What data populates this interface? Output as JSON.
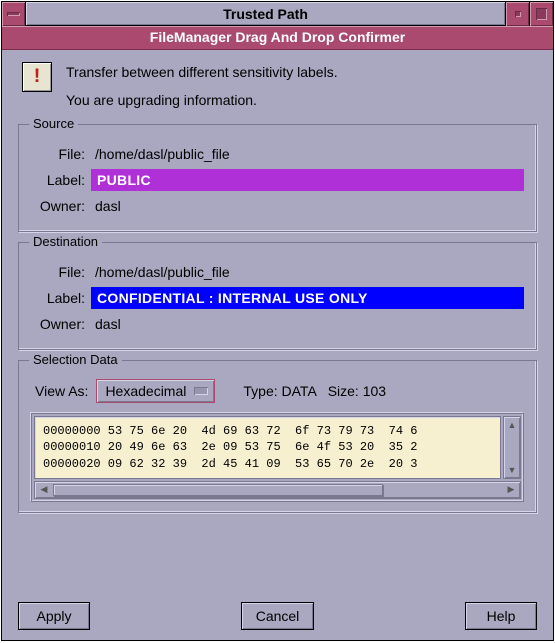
{
  "window": {
    "title": "Trusted Path",
    "subtitle": "FileManager Drag And Drop Confirmer"
  },
  "message": {
    "line1": "Transfer between different sensitivity labels.",
    "line2": "You are upgrading information."
  },
  "source": {
    "legend": "Source",
    "file_label": "File:",
    "file_value": "/home/dasl/public_file",
    "label_label": "Label:",
    "label_value": "PUBLIC",
    "label_color": "#b030d8",
    "owner_label": "Owner:",
    "owner_value": "dasl"
  },
  "destination": {
    "legend": "Destination",
    "file_label": "File:",
    "file_value": "/home/dasl/public_file",
    "label_label": "Label:",
    "label_value": "CONFIDENTIAL : INTERNAL USE ONLY",
    "label_color": "#0000ff",
    "owner_label": "Owner:",
    "owner_value": "dasl"
  },
  "selection": {
    "legend": "Selection Data",
    "viewas_label": "View As:",
    "viewas_value": "Hexadecimal",
    "type_label": "Type:",
    "type_value": "DATA",
    "size_label": "Size:",
    "size_value": "103",
    "hexdump": "00000000 53 75 6e 20  4d 69 63 72  6f 73 79 73  74 6\n00000010 20 49 6e 63  2e 09 53 75  6e 4f 53 20  35 2\n00000020 09 62 32 39  2d 45 41 09  53 65 70 2e  20 3"
  },
  "buttons": {
    "apply": "Apply",
    "cancel": "Cancel",
    "help": "Help"
  },
  "icons": {
    "alert": "!"
  }
}
